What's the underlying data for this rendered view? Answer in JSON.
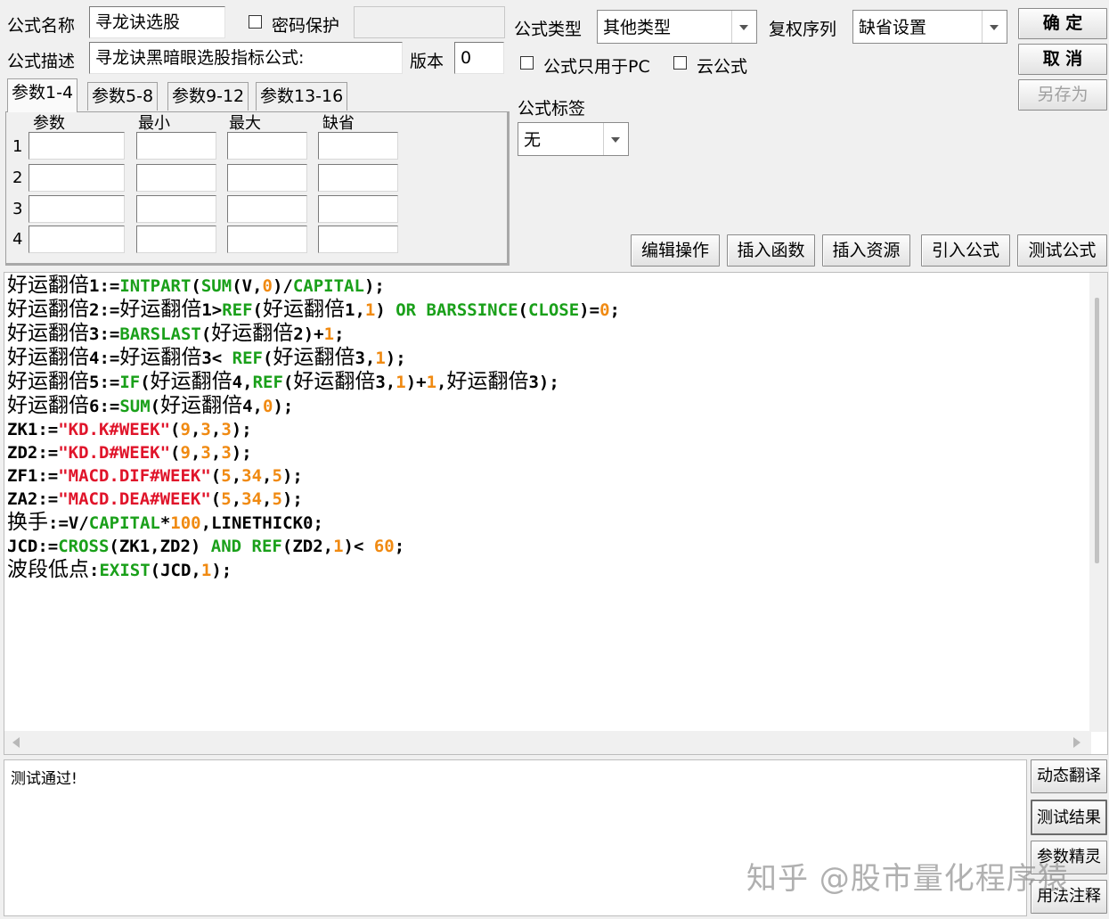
{
  "form": {
    "name_label": "公式名称",
    "name_value": "寻龙诀选股",
    "password_label": "密码保护",
    "password_value": "",
    "desc_label": "公式描述",
    "desc_value": "寻龙诀黑暗眼选股指标公式:",
    "version_label": "版本",
    "version_value": "0",
    "type_label": "公式类型",
    "type_value": "其他类型",
    "restore_label": "复权序列",
    "restore_value": "缺省设置",
    "pc_only_label": "公式只用于PC",
    "cloud_label": "云公式",
    "tag_label": "公式标签",
    "tag_value": "无"
  },
  "buttons": {
    "ok": "确  定",
    "cancel": "取  消",
    "save_as": "另存为"
  },
  "tabs": [
    "参数1-4",
    "参数5-8",
    "参数9-12",
    "参数13-16"
  ],
  "params": {
    "headers": [
      "参数",
      "最小",
      "最大",
      "缺省"
    ],
    "rows": [
      "1",
      "2",
      "3",
      "4"
    ]
  },
  "toolbar": [
    "编辑操作",
    "插入函数",
    "插入资源",
    "引入公式",
    "测试公式"
  ],
  "code_lines": [
    [
      [
        "c",
        "好运翻倍"
      ],
      [
        "t",
        "1:="
      ],
      [
        "f",
        "INTPART"
      ],
      [
        "t",
        "("
      ],
      [
        "f",
        "SUM"
      ],
      [
        "t",
        "(V,"
      ],
      [
        "n",
        "0"
      ],
      [
        "t",
        ")/"
      ],
      [
        "f",
        "CAPITAL"
      ],
      [
        "t",
        ");"
      ]
    ],
    [
      [
        "c",
        "好运翻倍"
      ],
      [
        "t",
        "2:="
      ],
      [
        "c",
        "好运翻倍"
      ],
      [
        "t",
        "1>"
      ],
      [
        "f",
        "REF"
      ],
      [
        "t",
        "("
      ],
      [
        "c",
        "好运翻倍"
      ],
      [
        "t",
        "1,"
      ],
      [
        "n",
        "1"
      ],
      [
        "t",
        ") "
      ],
      [
        "f",
        "OR BARSSINCE"
      ],
      [
        "t",
        "("
      ],
      [
        "f",
        "CLOSE"
      ],
      [
        "t",
        ")="
      ],
      [
        "n",
        "0"
      ],
      [
        "t",
        ";"
      ]
    ],
    [
      [
        "c",
        "好运翻倍"
      ],
      [
        "t",
        "3:="
      ],
      [
        "f",
        "BARSLAST"
      ],
      [
        "t",
        "("
      ],
      [
        "c",
        "好运翻倍"
      ],
      [
        "t",
        "2)+"
      ],
      [
        "n",
        "1"
      ],
      [
        "t",
        ";"
      ]
    ],
    [
      [
        "c",
        "好运翻倍"
      ],
      [
        "t",
        "4:="
      ],
      [
        "c",
        "好运翻倍"
      ],
      [
        "t",
        "3< "
      ],
      [
        "f",
        "REF"
      ],
      [
        "t",
        "("
      ],
      [
        "c",
        "好运翻倍"
      ],
      [
        "t",
        "3,"
      ],
      [
        "n",
        "1"
      ],
      [
        "t",
        ");"
      ]
    ],
    [
      [
        "c",
        "好运翻倍"
      ],
      [
        "t",
        "5:="
      ],
      [
        "f",
        "IF"
      ],
      [
        "t",
        "("
      ],
      [
        "c",
        "好运翻倍"
      ],
      [
        "t",
        "4,"
      ],
      [
        "f",
        "REF"
      ],
      [
        "t",
        "("
      ],
      [
        "c",
        "好运翻倍"
      ],
      [
        "t",
        "3,"
      ],
      [
        "n",
        "1"
      ],
      [
        "t",
        ")+"
      ],
      [
        "n",
        "1"
      ],
      [
        "t",
        ","
      ],
      [
        "c",
        "好运翻倍"
      ],
      [
        "t",
        "3);"
      ]
    ],
    [
      [
        "c",
        "好运翻倍"
      ],
      [
        "t",
        "6:="
      ],
      [
        "f",
        "SUM"
      ],
      [
        "t",
        "("
      ],
      [
        "c",
        "好运翻倍"
      ],
      [
        "t",
        "4,"
      ],
      [
        "n",
        "0"
      ],
      [
        "t",
        ");"
      ]
    ],
    [
      [
        "t",
        "ZK1:="
      ],
      [
        "s",
        "\"KD.K#WEEK\""
      ],
      [
        "t",
        "("
      ],
      [
        "n",
        "9"
      ],
      [
        "t",
        ","
      ],
      [
        "n",
        "3"
      ],
      [
        "t",
        ","
      ],
      [
        "n",
        "3"
      ],
      [
        "t",
        ");"
      ]
    ],
    [
      [
        "t",
        "ZD2:="
      ],
      [
        "s",
        "\"KD.D#WEEK\""
      ],
      [
        "t",
        "("
      ],
      [
        "n",
        "9"
      ],
      [
        "t",
        ","
      ],
      [
        "n",
        "3"
      ],
      [
        "t",
        ","
      ],
      [
        "n",
        "3"
      ],
      [
        "t",
        ");"
      ]
    ],
    [
      [
        "t",
        "ZF1:="
      ],
      [
        "s",
        "\"MACD.DIF#WEEK\""
      ],
      [
        "t",
        "("
      ],
      [
        "n",
        "5"
      ],
      [
        "t",
        ","
      ],
      [
        "n",
        "34"
      ],
      [
        "t",
        ","
      ],
      [
        "n",
        "5"
      ],
      [
        "t",
        ");"
      ]
    ],
    [
      [
        "t",
        "ZA2:="
      ],
      [
        "s",
        "\"MACD.DEA#WEEK\""
      ],
      [
        "t",
        "("
      ],
      [
        "n",
        "5"
      ],
      [
        "t",
        ","
      ],
      [
        "n",
        "34"
      ],
      [
        "t",
        ","
      ],
      [
        "n",
        "5"
      ],
      [
        "t",
        ");"
      ]
    ],
    [
      [
        "c",
        "换手"
      ],
      [
        "t",
        ":=V/"
      ],
      [
        "f",
        "CAPITAL"
      ],
      [
        "t",
        "*"
      ],
      [
        "n",
        "100"
      ],
      [
        "t",
        ",LINETHICK0;"
      ]
    ],
    [
      [
        "t",
        "JCD:="
      ],
      [
        "f",
        "CROSS"
      ],
      [
        "t",
        "(ZK1,ZD2) "
      ],
      [
        "f",
        "AND REF"
      ],
      [
        "t",
        "(ZD2,"
      ],
      [
        "n",
        "1"
      ],
      [
        "t",
        ")< "
      ],
      [
        "n",
        "60"
      ],
      [
        "t",
        ";"
      ]
    ],
    [
      [
        "c",
        "波段低点"
      ],
      [
        "t",
        ":"
      ],
      [
        "f",
        "EXIST"
      ],
      [
        "t",
        "(JCD,"
      ],
      [
        "n",
        "1"
      ],
      [
        "t",
        ");"
      ]
    ]
  ],
  "output_text": "测试通过!",
  "side_buttons": [
    "动态翻译",
    "测试结果",
    "参数精灵",
    "用法注释"
  ],
  "watermark": "知乎 @股市量化程序猿"
}
